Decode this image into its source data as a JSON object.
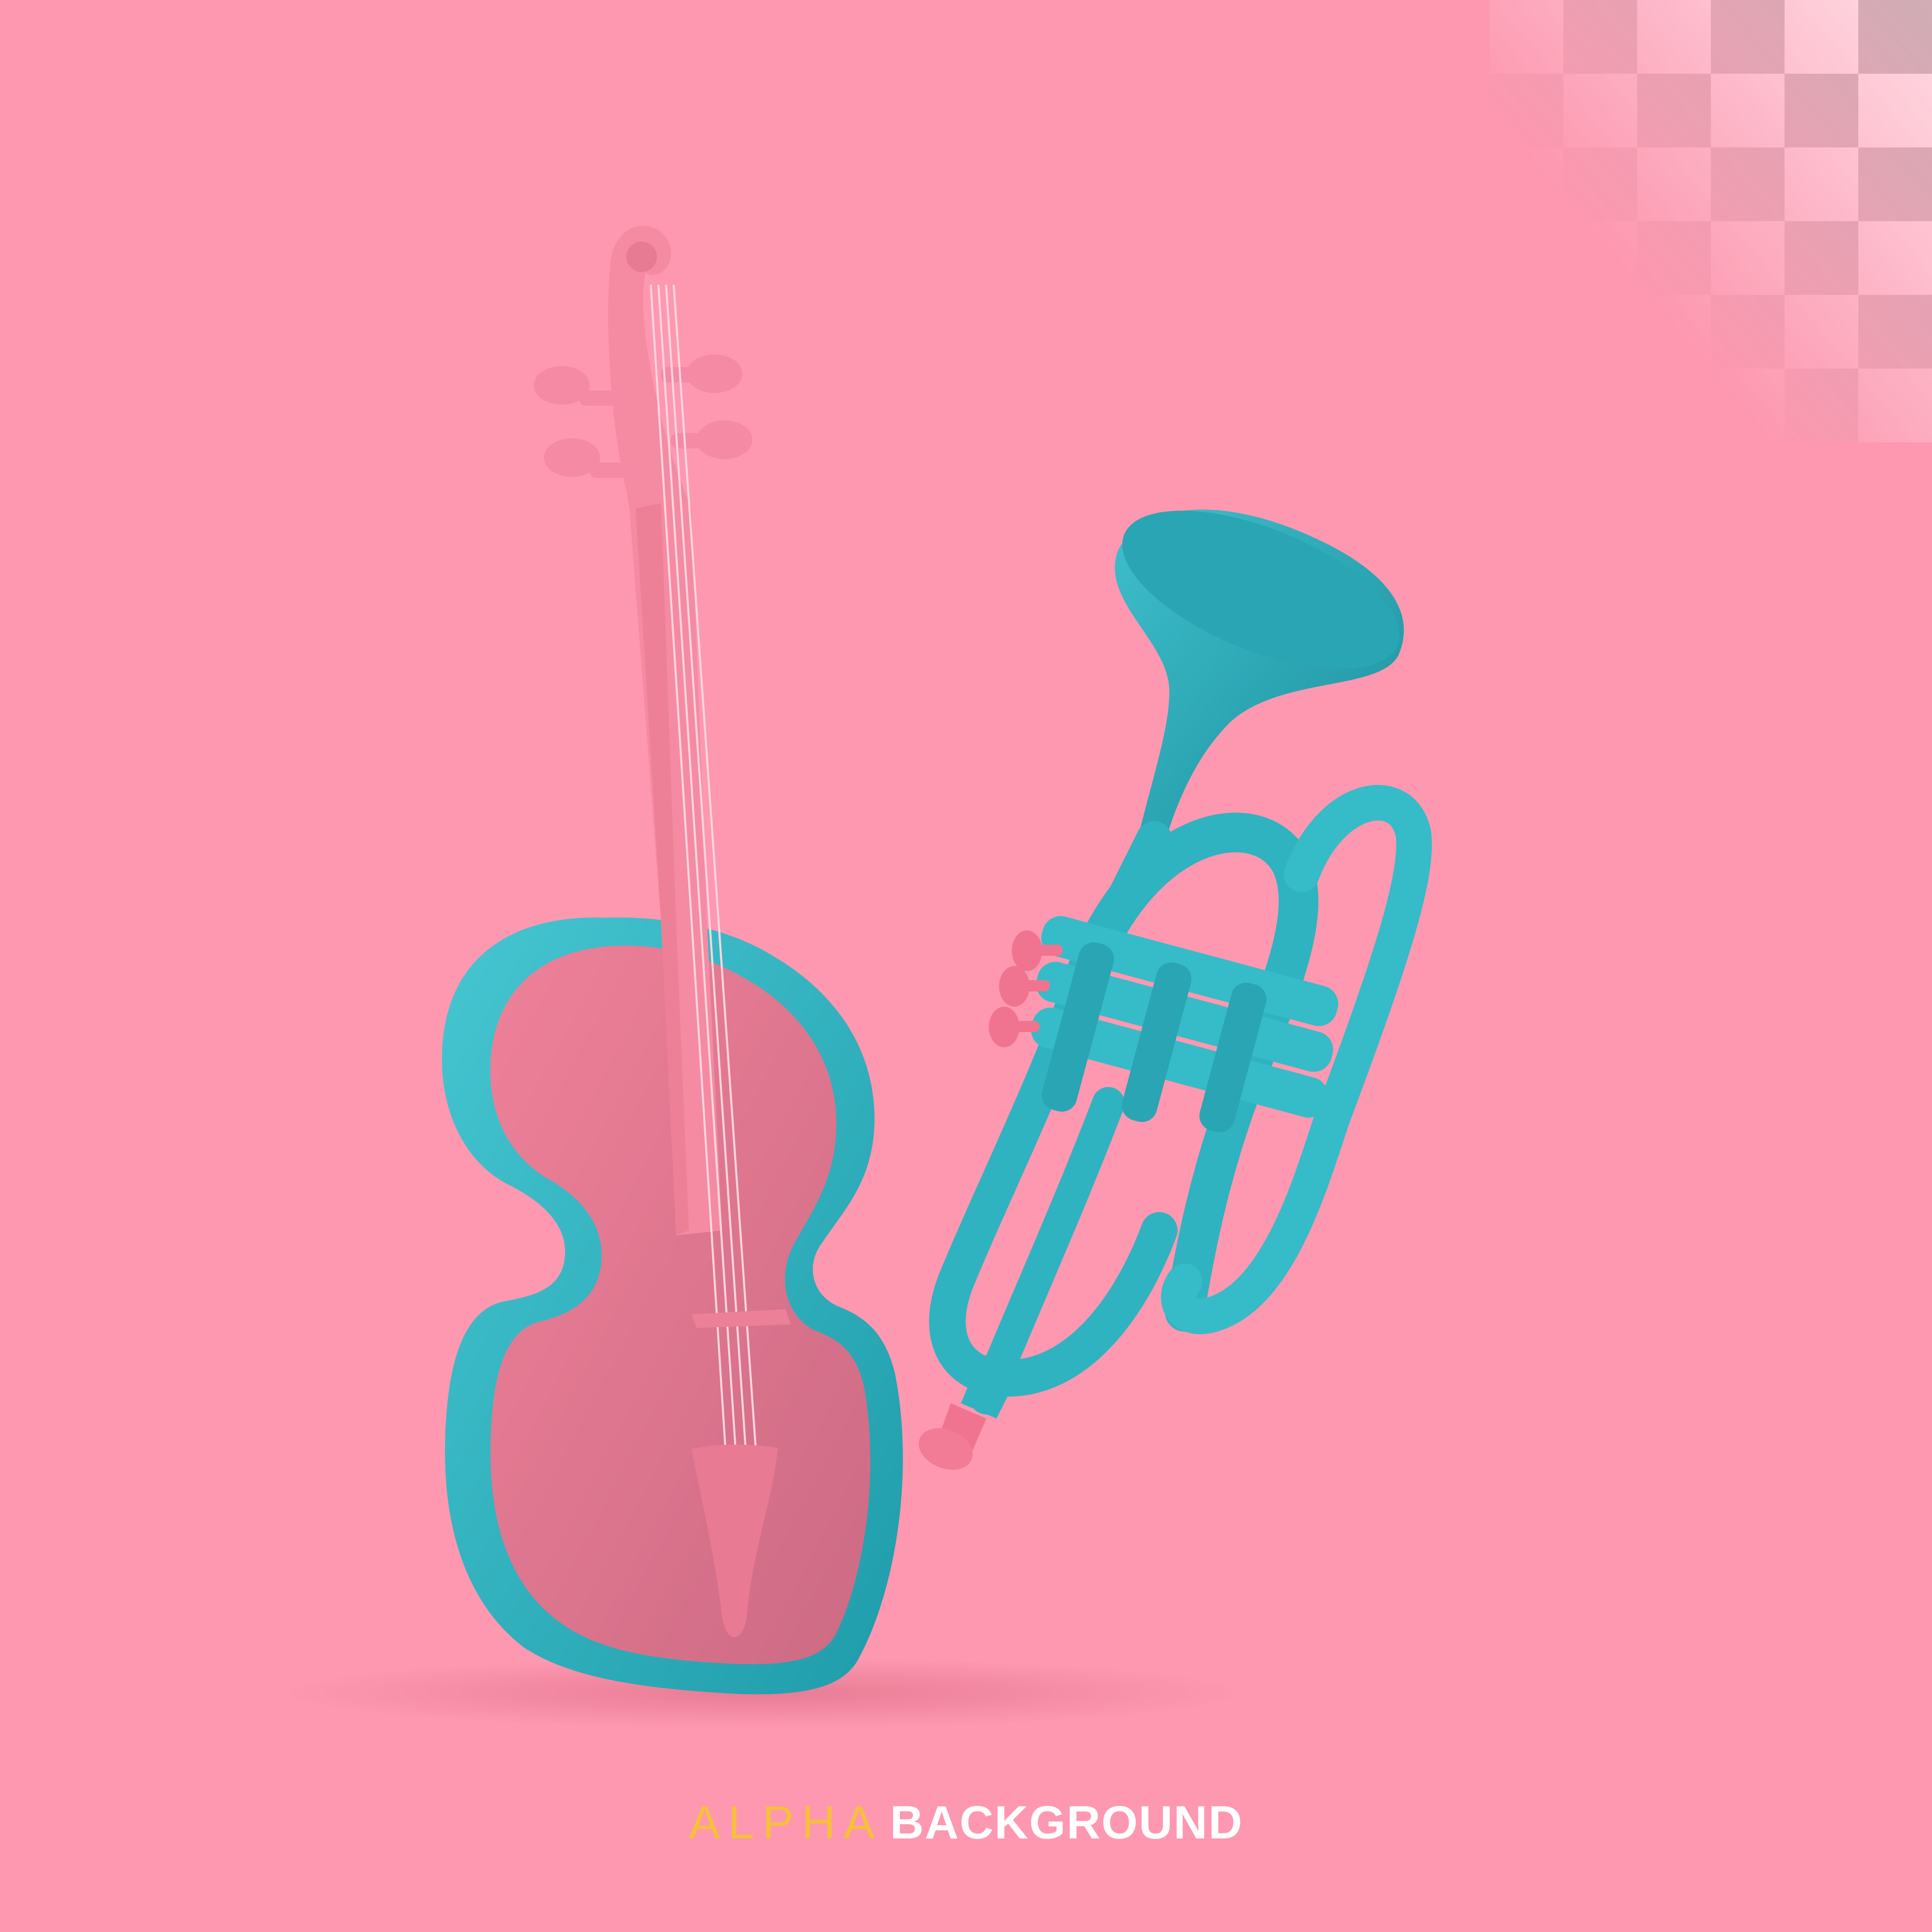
{
  "caption": {
    "word_1": "ALPHA",
    "word_2": "BACKGROUND"
  },
  "colors": {
    "background": "#fd98b0",
    "accent_pink": "#f58aa3",
    "teal": "#2fb3c0",
    "caption_word_1": "#f5c03a",
    "caption_word_2": "#ffffff"
  },
  "scene": {
    "objects": [
      "violin-illustration",
      "trumpet-illustration",
      "transparency-checkerboard"
    ]
  }
}
